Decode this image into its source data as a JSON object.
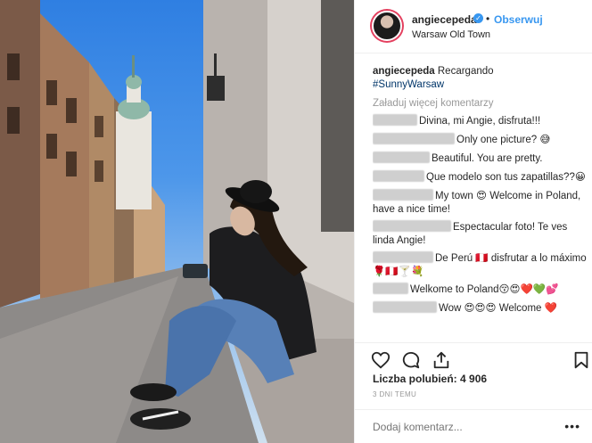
{
  "post": {
    "username": "angiecepeda",
    "verified_icon": "verified-badge-icon",
    "separator": "•",
    "follow_label": "Obserwuj",
    "location": "Warsaw Old Town",
    "caption_user": "angiecepeda",
    "caption_text": " Recargando",
    "caption_hashtag": "#SunnyWarsaw",
    "load_more": "Załaduj więcej komentarzy",
    "comments": [
      {
        "text": "Divina, mi Angie, disfruta!!!"
      },
      {
        "text": "Only one picture? 😅"
      },
      {
        "text": "Beautiful. You are pretty."
      },
      {
        "text": "Que modelo son tus zapatillas??😀"
      },
      {
        "text": "My town 😍 Welcome in Poland, have a nice time!"
      },
      {
        "text": "Espectacular foto! Te ves linda Angie!"
      },
      {
        "text": "De Perú 🇵🇪 disfrutar a lo máximo 🌹🇵🇪🍸💐"
      },
      {
        "text": "Welkome to Poland😚😍❤️💚💕"
      },
      {
        "text": "Wow 😍😍😍 Welcome ❤️"
      }
    ],
    "likes_label": "Liczba polubień:",
    "likes_count": "4 906",
    "time_ago": "3 DNI TEMU",
    "comment_placeholder": "Dodaj komentarz...",
    "more_label": "•••"
  },
  "icons": {
    "like": "heart-icon",
    "comment": "comment-bubble-icon",
    "share": "share-icon",
    "save": "bookmark-icon"
  },
  "colors": {
    "accent": "#3897f0",
    "hashtag": "#003569",
    "muted": "#999999"
  }
}
